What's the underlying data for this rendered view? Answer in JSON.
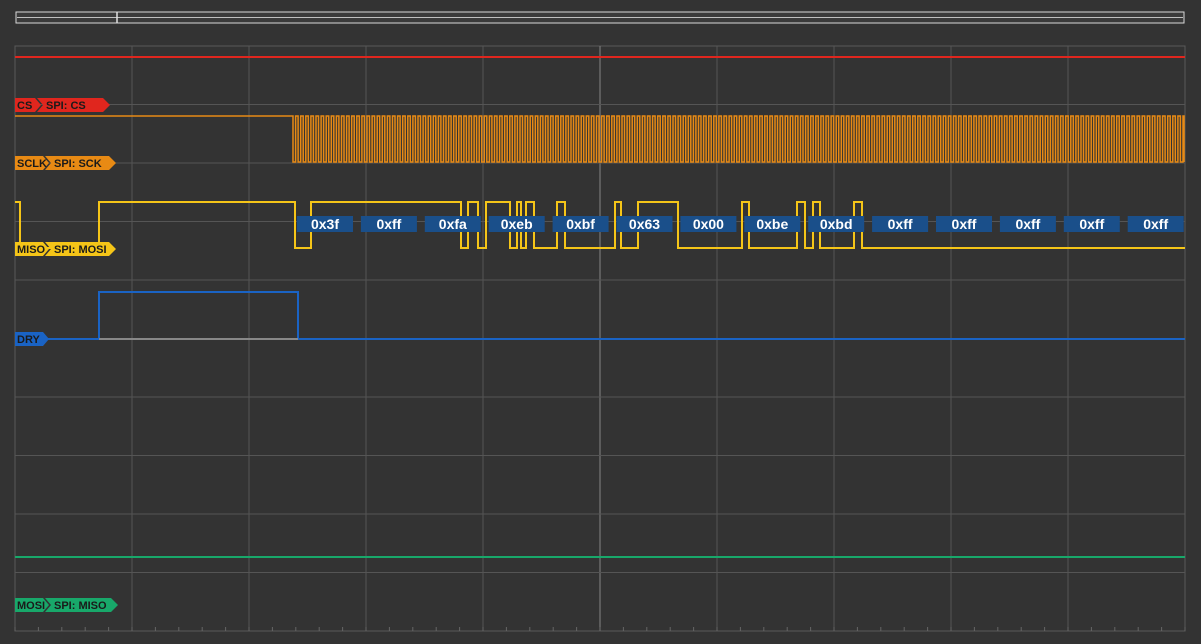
{
  "colors": {
    "background": "#333333",
    "grid": "#555555",
    "grid_center": "#777777",
    "cs": "#e0261e",
    "sck": "#e88a14",
    "mosi": "#f5c518",
    "dry": "#1a63c4",
    "miso": "#18a86a",
    "decode_box": "#1a4f8a"
  },
  "channels": [
    {
      "id": "cs",
      "name": "CS",
      "decoder": "SPI: CS",
      "color": "#e0261e"
    },
    {
      "id": "sck",
      "name": "SCLK",
      "decoder": "SPI: SCK",
      "color": "#e88a14"
    },
    {
      "id": "mosi",
      "name": "MISO",
      "decoder": "SPI: MOSI",
      "color": "#f5c518"
    },
    {
      "id": "dry",
      "name": "DRY",
      "decoder": "",
      "color": "#1a63c4"
    },
    {
      "id": "miso",
      "name": "MOSI",
      "decoder": "SPI: MISO",
      "color": "#18a86a"
    }
  ],
  "decoded_bytes": [
    "0x3f",
    "0xff",
    "0xfa",
    "0xeb",
    "0xbf",
    "0x63",
    "0x00",
    "0xbe",
    "0xbd",
    "0xff",
    "0xff",
    "0xff",
    "0xff",
    "0xff"
  ],
  "icons": {
    "marker": "cursor-marker-icon",
    "timeline": "timeline-scrollbar"
  }
}
